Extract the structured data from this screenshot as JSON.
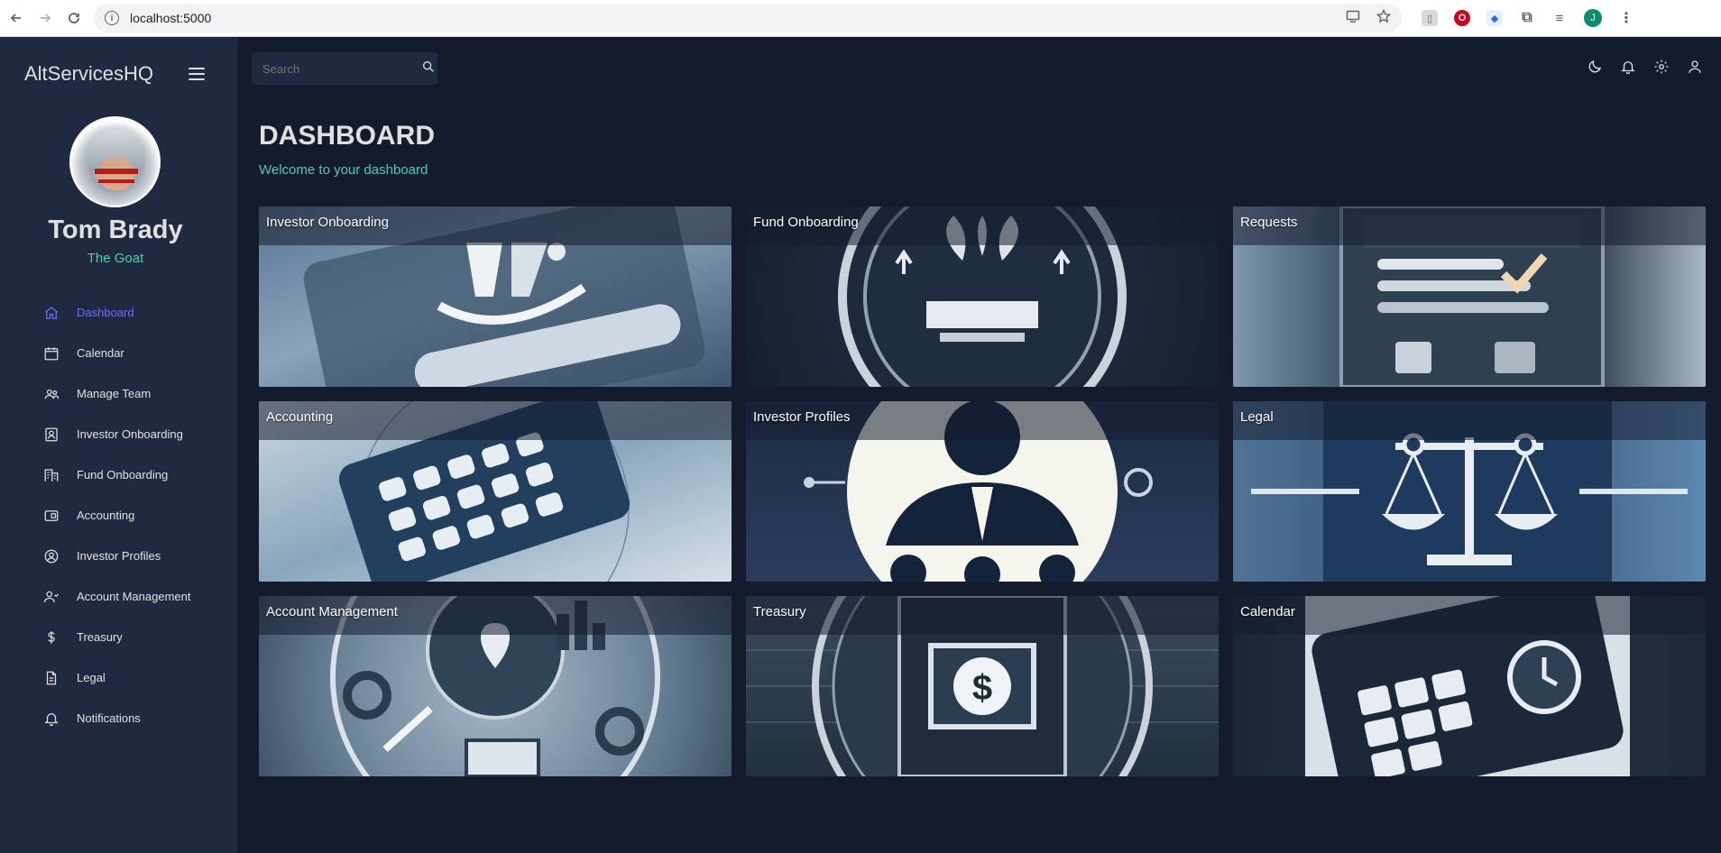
{
  "browser": {
    "url": "localhost:5000",
    "profile_initial": "J"
  },
  "sidebar": {
    "brand": "AltServicesHQ",
    "user": {
      "name": "Tom Brady",
      "title": "The Goat"
    },
    "items": [
      {
        "label": "Dashboard",
        "icon": "home-icon",
        "active": true
      },
      {
        "label": "Calendar",
        "icon": "calendar-icon"
      },
      {
        "label": "Manage Team",
        "icon": "people-icon"
      },
      {
        "label": "Investor Onboarding",
        "icon": "contact-card-icon"
      },
      {
        "label": "Fund Onboarding",
        "icon": "building-icon"
      },
      {
        "label": "Accounting",
        "icon": "wallet-icon"
      },
      {
        "label": "Investor Profiles",
        "icon": "profile-circle-icon"
      },
      {
        "label": "Account Management",
        "icon": "account-manage-icon"
      },
      {
        "label": "Treasury",
        "icon": "dollar-icon"
      },
      {
        "label": "Legal",
        "icon": "document-icon"
      },
      {
        "label": "Notifications",
        "icon": "bell-icon"
      }
    ]
  },
  "topbar": {
    "search_placeholder": "Search",
    "icons": [
      "dark-mode-icon",
      "notifications-icon",
      "settings-icon",
      "person-icon"
    ]
  },
  "header": {
    "title": "DASHBOARD",
    "subtitle": "Welcome to your dashboard"
  },
  "cards": [
    {
      "label": "Investor Onboarding"
    },
    {
      "label": "Fund Onboarding"
    },
    {
      "label": "Requests"
    },
    {
      "label": "Accounting"
    },
    {
      "label": "Investor Profiles"
    },
    {
      "label": "Legal"
    },
    {
      "label": "Account Management"
    },
    {
      "label": "Treasury"
    },
    {
      "label": "Calendar"
    }
  ],
  "colors": {
    "background": "#141b2d",
    "sidebar": "#1f2a40",
    "accent_green": "#4cceac",
    "active_blue": "#6870fa",
    "text": "#e0e0e0"
  }
}
